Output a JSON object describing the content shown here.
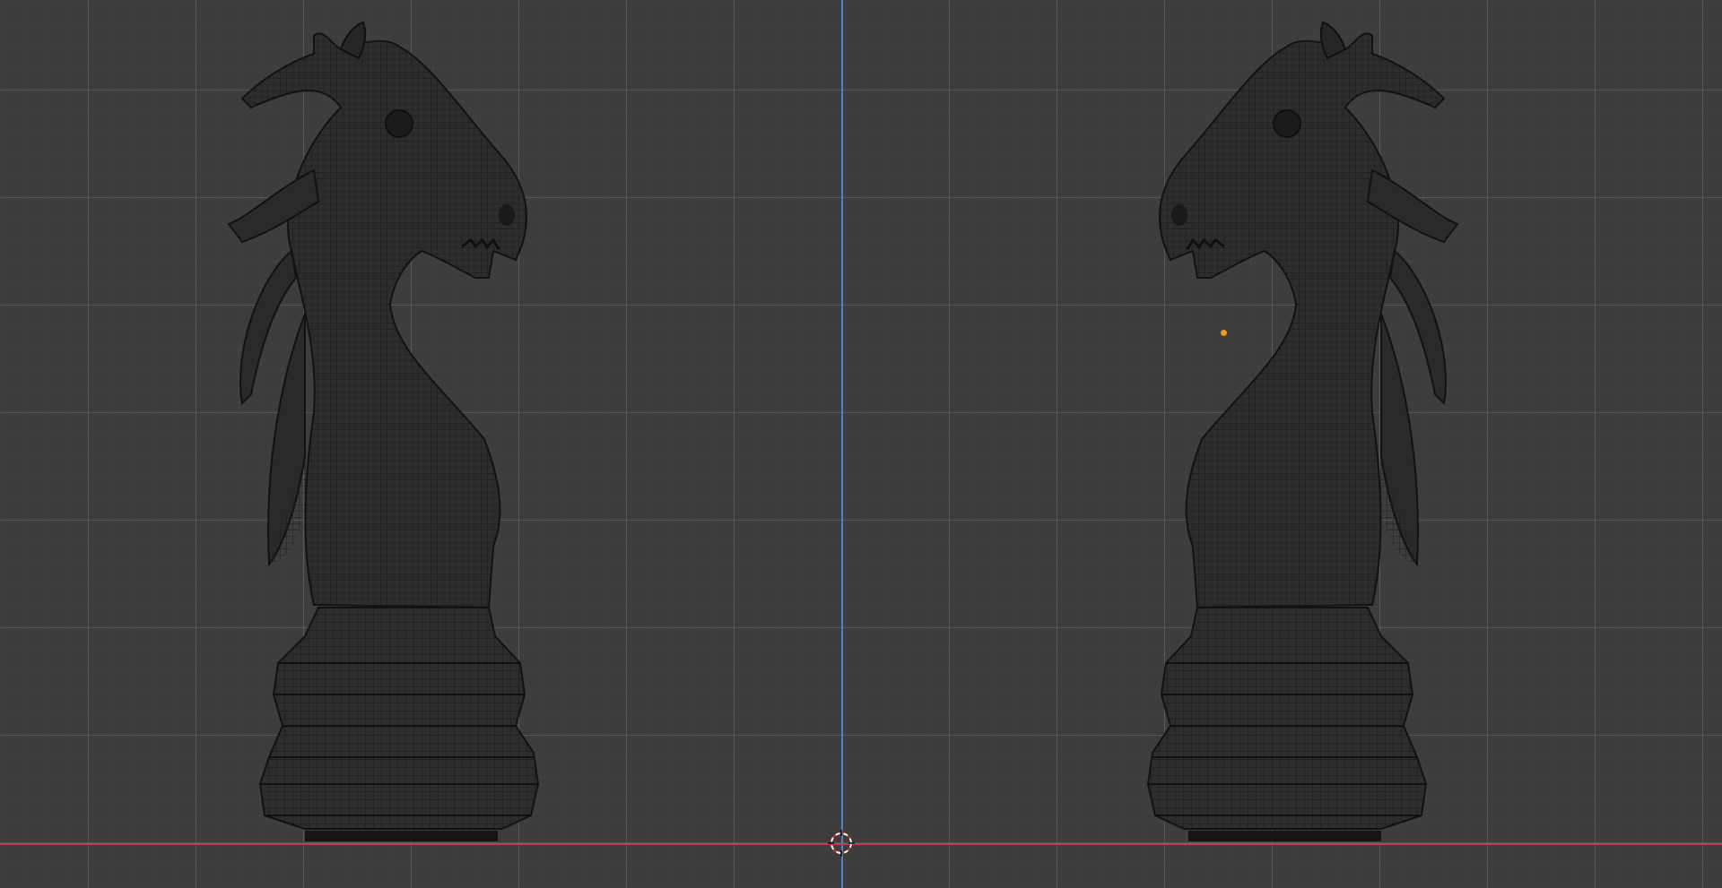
{
  "viewport": {
    "background_color": "#3d3d3d",
    "grid_major_color": "#5c5c5c",
    "grid_minor_color": "#424242",
    "axis_y_color": "#4f7fc8",
    "axis_x_color": "#b8434f",
    "object_color": "#2d2d2d",
    "wire_color": "#151515",
    "origin_color": "#f29a1c",
    "cursor_icon": "3d-cursor-icon"
  },
  "objects": [
    {
      "name": "knight-left",
      "facing": "right"
    },
    {
      "name": "knight-right",
      "facing": "left"
    }
  ]
}
